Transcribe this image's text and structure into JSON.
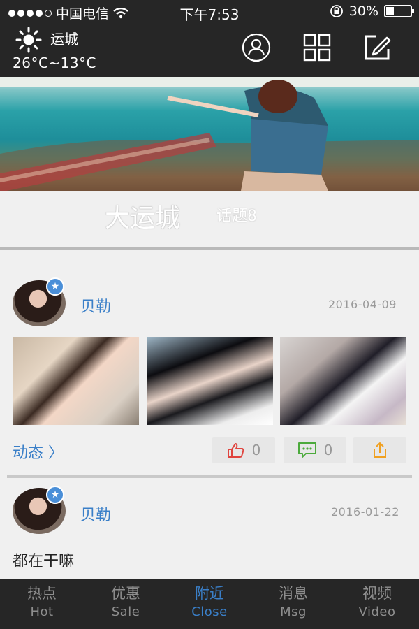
{
  "status_bar": {
    "carrier": "中国电信",
    "time": "下午7:53",
    "battery": "30%",
    "battery_level": 0.3
  },
  "header": {
    "city": "运城",
    "temperature": "26°C~13°C",
    "icons": [
      "sun-icon",
      "profile-icon",
      "grid-icon",
      "compose-icon"
    ]
  },
  "banner": {
    "title": "大运城",
    "topic": "话题8"
  },
  "posts": [
    {
      "author": "贝勒",
      "date": "2016-04-09",
      "dynamic_link": "动态 〉",
      "likes": "0",
      "comments": "0"
    },
    {
      "author": "贝勒",
      "date": "2016-01-22",
      "text": "都在干嘛"
    }
  ],
  "tabs": [
    {
      "zh": "热点",
      "en": "Hot"
    },
    {
      "zh": "优惠",
      "en": "Sale"
    },
    {
      "zh": "附近",
      "en": "Close"
    },
    {
      "zh": "消息",
      "en": "Msg"
    },
    {
      "zh": "视频",
      "en": "Video"
    }
  ],
  "colors": {
    "accent": "#3a7fc8",
    "bar_bg": "#262626",
    "page_bg": "#f0f0f0"
  }
}
